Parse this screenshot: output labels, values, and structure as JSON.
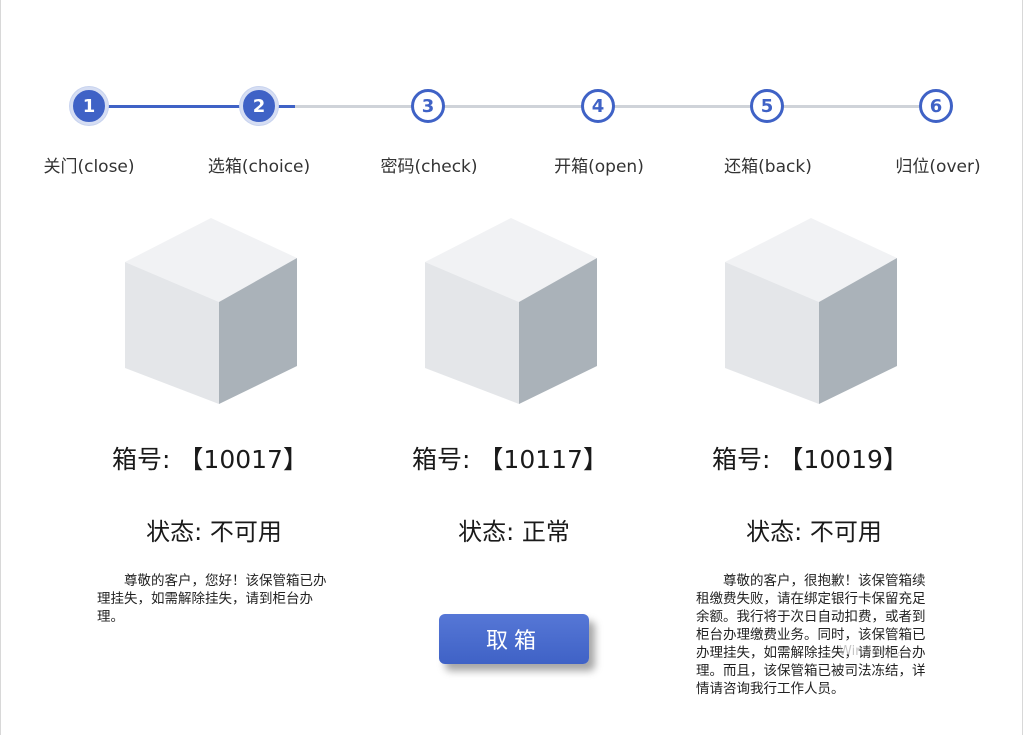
{
  "steps": [
    {
      "number": "1",
      "label": "关门(close)",
      "state": "active"
    },
    {
      "number": "2",
      "label": "选箱(choice)",
      "state": "active"
    },
    {
      "number": "3",
      "label": "密码(check)",
      "state": "pending"
    },
    {
      "number": "4",
      "label": "开箱(open)",
      "state": "pending"
    },
    {
      "number": "5",
      "label": "还箱(back)",
      "state": "pending"
    },
    {
      "number": "6",
      "label": "归位(over)",
      "state": "pending"
    }
  ],
  "boxes": [
    {
      "number_text": "箱号: 【10017】",
      "status_text": "状态: 不可用",
      "notice": "尊敬的客户，您好！该保管箱已办理挂失，如需解除挂失，请到柜台办理。"
    },
    {
      "number_text": "箱号: 【10117】",
      "status_text": "状态: 正常",
      "notice": ""
    },
    {
      "number_text": "箱号: 【10019】",
      "status_text": "状态: 不可用",
      "notice": "尊敬的客户，很抱歉！该保管箱续租缴费失败，请在绑定银行卡保留充足余额。我行将于次日自动扣费，或者到柜台办理缴费业务。同时，该保管箱已办理挂失，如需解除挂失，请到柜台办理。而且，该保管箱已被司法冻结，详情请咨询我行工作人员。"
    }
  ],
  "cancel_button": {
    "label": "取箱"
  },
  "watermark": "Windows。",
  "colors": {
    "accent": "#3f62c6",
    "pending_line": "#cfd3d9",
    "cube_top": "#f1f2f4",
    "cube_left": "#e4e6e9",
    "cube_right": "#aab2b9"
  }
}
